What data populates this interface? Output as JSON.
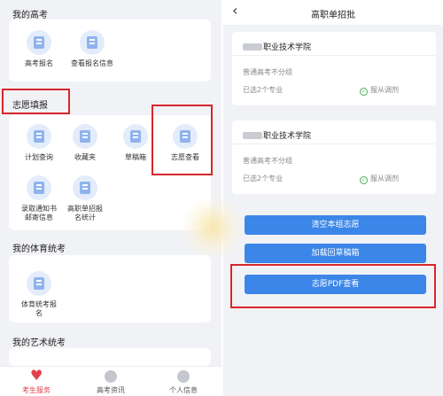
{
  "left": {
    "my_exam": {
      "title": "我的高考",
      "tiles": [
        "高考报名",
        "查看报名信息"
      ]
    },
    "volunteer": {
      "title": "志愿填报",
      "tiles": [
        "计划查询",
        "收藏夹",
        "草稿箱",
        "志愿查看",
        "录取通知书邮寄信息",
        "高职单招报名统计"
      ]
    },
    "sports_exam": {
      "title": "我的体育统考",
      "tiles": [
        "体育统考报名"
      ]
    },
    "art_exam": {
      "title": "我的艺术统考"
    },
    "bottom_nav": [
      "考生服务",
      "高考资讯",
      "个人信息"
    ]
  },
  "right": {
    "back_glyph": "‹",
    "title": "高职单招批",
    "schools": [
      {
        "name": "职业技术学院",
        "sub": "普通高考不分组",
        "chosen": "已选2个专业",
        "obey": "服从调剂"
      },
      {
        "name": "职业技术学院",
        "sub": "普通高考不分组",
        "chosen": "已选2个专业",
        "obey": "服从调剂"
      }
    ],
    "buttons": [
      "清空本组志愿",
      "加载回草稿箱",
      "志愿PDF查看"
    ]
  },
  "colors": {
    "accent": "#3b86e8",
    "highlight": "#d6262b",
    "active_nav": "#e0434a"
  }
}
